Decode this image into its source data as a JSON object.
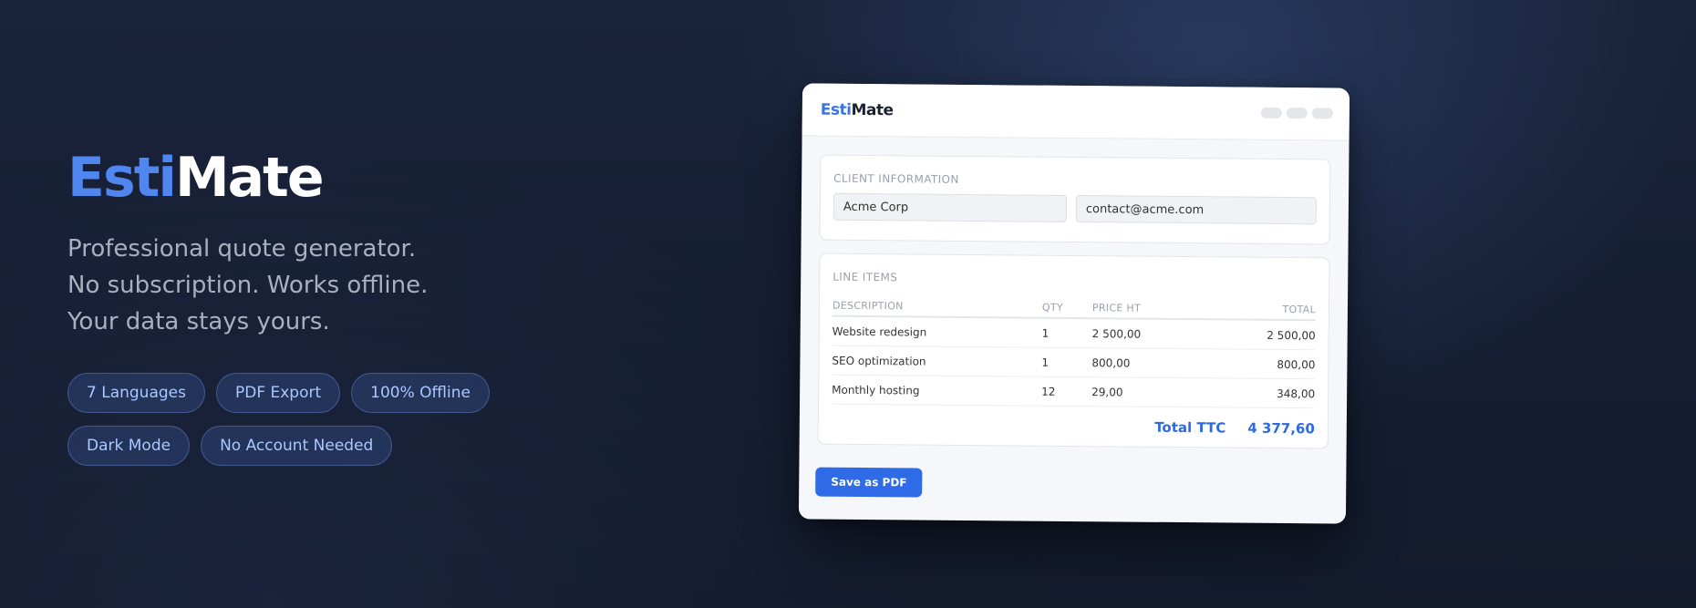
{
  "hero": {
    "brand_part1": "Esti",
    "brand_part2": "Mate",
    "tagline": [
      "Professional quote generator.",
      "No subscription. Works offline.",
      "Your data stays yours."
    ],
    "features": [
      "7 Languages",
      "PDF Export",
      "100% Offline",
      "Dark Mode",
      "No Account Needed"
    ]
  },
  "app": {
    "logo_part1": "Esti",
    "logo_part2": "Mate",
    "client": {
      "title": "CLIENT INFORMATION",
      "company_value": "Acme Corp",
      "email_value": "contact@acme.com"
    },
    "line_items": {
      "title": "LINE ITEMS",
      "columns": [
        "DESCRIPTION",
        "QTY",
        "PRICE HT",
        "TOTAL"
      ],
      "rows": [
        {
          "description": "Website redesign",
          "qty": "1",
          "price": "2 500,00",
          "total": "2 500,00"
        },
        {
          "description": "SEO optimization",
          "qty": "1",
          "price": "800,00",
          "total": "800,00"
        },
        {
          "description": "Monthly hosting",
          "qty": "12",
          "price": "29,00",
          "total": "348,00"
        }
      ],
      "total_label": "Total TTC",
      "total_value": "4 377,60"
    },
    "save_label": "Save as PDF"
  },
  "colors": {
    "accent": "#4f86f0",
    "button": "#2f6be6",
    "background": "#151d30"
  }
}
